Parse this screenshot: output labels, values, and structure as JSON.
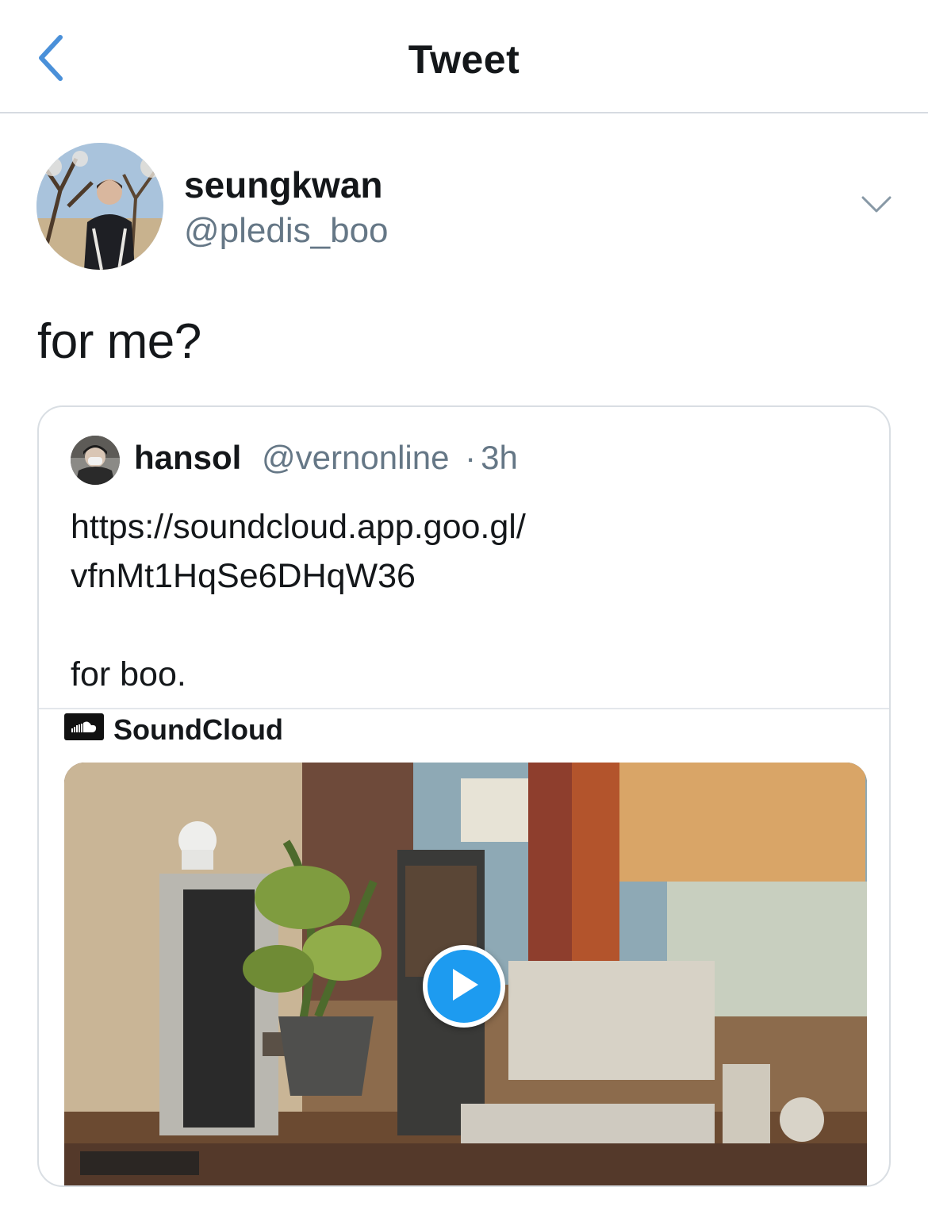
{
  "nav": {
    "title": "Tweet"
  },
  "tweet": {
    "author": {
      "name": "seungkwan",
      "handle": "@pledis_boo"
    },
    "text": "for me?"
  },
  "quote": {
    "author": {
      "name": "hansol",
      "handle": "@vernonline",
      "separator": "·",
      "time": "3h"
    },
    "text_lines": [
      "https://soundcloud.app.goo.gl/",
      "vfnMt1HqSe6DHqW36",
      "",
      "for boo."
    ],
    "card": {
      "provider": "SoundCloud"
    }
  },
  "colors": {
    "accent": "#1d9bf0",
    "back_chevron": "#4a90d9",
    "secondary_text": "#657786"
  },
  "icons": {
    "back": "chevron-left-icon",
    "more": "chevron-down-icon",
    "provider": "soundcloud-logo-icon",
    "play": "play-icon"
  }
}
